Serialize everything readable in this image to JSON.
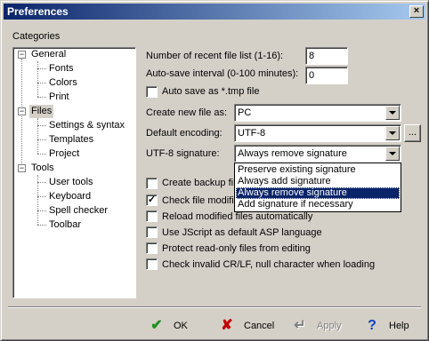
{
  "window": {
    "title": "Preferences",
    "close_glyph": "×"
  },
  "categories": {
    "label": "Categories",
    "tree": [
      {
        "label": "General",
        "level": 0,
        "expanded": true
      },
      {
        "label": "Fonts",
        "level": 1
      },
      {
        "label": "Colors",
        "level": 1
      },
      {
        "label": "Print",
        "level": 1
      },
      {
        "label": "Files",
        "level": 0,
        "expanded": true,
        "selected": true
      },
      {
        "label": "Settings & syntax",
        "level": 1
      },
      {
        "label": "Templates",
        "level": 1
      },
      {
        "label": "Project",
        "level": 1
      },
      {
        "label": "Tools",
        "level": 0,
        "expanded": true
      },
      {
        "label": "User tools",
        "level": 1
      },
      {
        "label": "Keyboard",
        "level": 1
      },
      {
        "label": "Spell checker",
        "level": 1
      },
      {
        "label": "Toolbar",
        "level": 1
      }
    ],
    "expander_glyph": "−"
  },
  "files": {
    "recent_label": "Number of recent file list (1-16):",
    "recent_value": "8",
    "autosave_label": "Auto-save interval (0-100 minutes):",
    "autosave_value": "0",
    "autosave_tmp_label": "Auto save as *.tmp file",
    "autosave_tmp_checked": false,
    "create_new_label": "Create new file as:",
    "create_new_value": "PC",
    "encoding_label": "Default encoding:",
    "encoding_value": "UTF-8",
    "encoding_more_label": "...",
    "utf8_sig_label": "UTF-8 signature:",
    "utf8_sig_value": "Always remove signature",
    "utf8_sig_options": [
      "Preserve existing signature",
      "Always add signature",
      "Always remove signature",
      "Add signature if necessary"
    ],
    "checkboxes": [
      {
        "label": "Create backup fil",
        "checked": false
      },
      {
        "label": "Check file modific",
        "checked": true
      },
      {
        "label": "Reload modified files automatically",
        "checked": false
      },
      {
        "label": "Use JScript as default ASP language",
        "checked": false
      },
      {
        "label": "Protect read-only files from editing",
        "checked": false
      },
      {
        "label": "Check invalid CR/LF, null character when loading",
        "checked": false
      }
    ]
  },
  "footer": {
    "ok_label": "OK",
    "cancel_label": "Cancel",
    "apply_label": "Apply",
    "help_label": "Help",
    "ok_color": "#1f8f1f",
    "cancel_color": "#c00000",
    "help_color": "#1040c0",
    "check_glyph": "✔",
    "cross_glyph": "✘",
    "apply_glyph": "↵",
    "help_glyph": "?"
  }
}
